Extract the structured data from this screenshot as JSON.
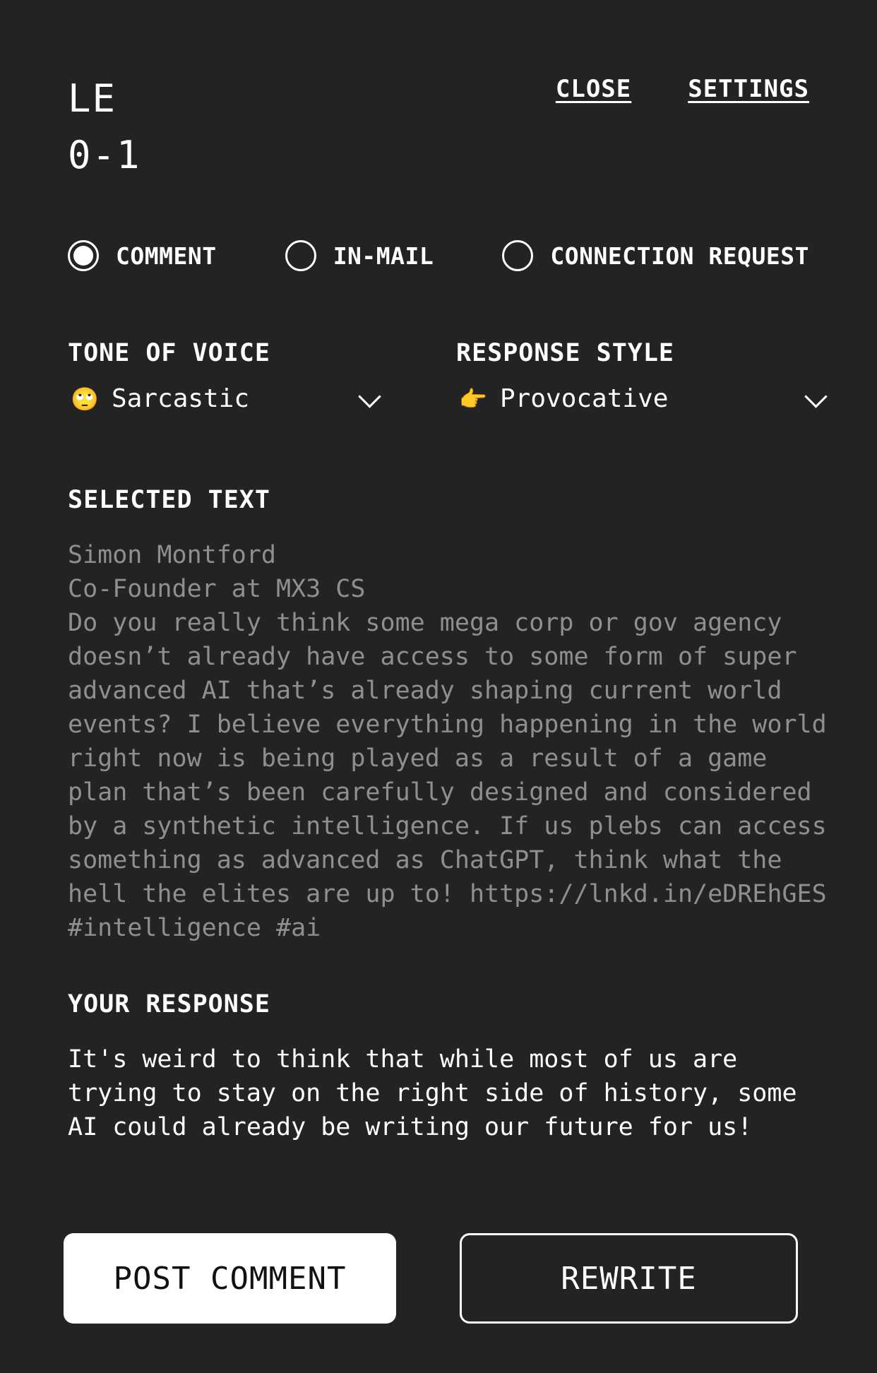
{
  "header": {
    "logo_line1": "LE",
    "logo_line2": "0-1",
    "close_label": "CLOSE",
    "settings_label": "SETTINGS"
  },
  "message_type": {
    "options": [
      "COMMENT",
      "IN-MAIL",
      "CONNECTION REQUEST"
    ],
    "selected": "COMMENT"
  },
  "tone": {
    "label": "TONE OF VOICE",
    "emoji": "🙄",
    "value": "Sarcastic"
  },
  "style": {
    "label": "RESPONSE STYLE",
    "emoji": "👉",
    "value": "Provocative"
  },
  "selected_text": {
    "label": "SELECTED TEXT",
    "content": "Simon Montford\nCo-Founder at MX3 CS\nDo you really think some mega corp or gov agency doesn’t already have access to some form of super advanced AI that’s already shaping current world events? I believe everything happening in the world right now is being played as a result of a game plan that’s been carefully designed and considered by a synthetic intelligence. If us plebs can access something as advanced as ChatGPT, think what the hell the elites are up to! https://lnkd.in/eDREhGES #intelligence #ai"
  },
  "response": {
    "label": "YOUR RESPONSE",
    "content": "It's weird to think that while most of us are trying to stay on the right side of history, some AI could already be writing our future for us!"
  },
  "actions": {
    "post_label": "POST COMMENT",
    "rewrite_label": "REWRITE"
  },
  "colors": {
    "background": "#232323",
    "text": "#ffffff",
    "muted_text": "#8f8f8f"
  }
}
